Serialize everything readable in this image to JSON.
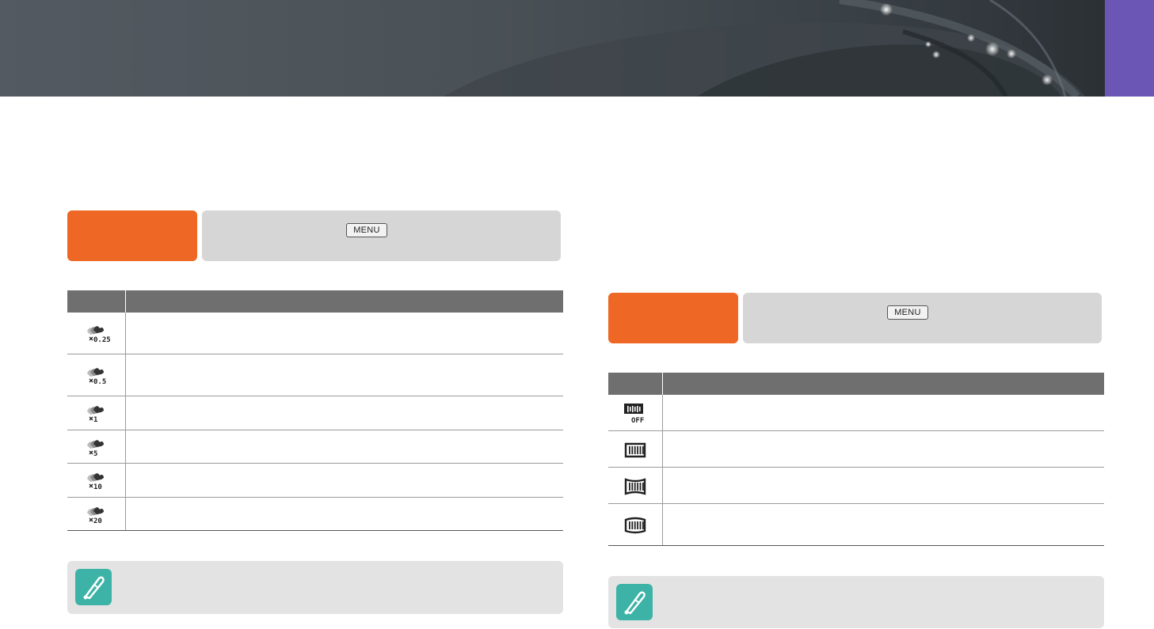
{
  "header": {
    "accent": "#6b55b5",
    "banner_color": "#4a5156"
  },
  "left_section": {
    "mode_color": "#ee6724",
    "menu_key": "MENU",
    "table_rows": [
      {
        "icon": "timelapse-x0.25-icon"
      },
      {
        "icon": "timelapse-x0.5-icon"
      },
      {
        "icon": "timelapse-x1-icon"
      },
      {
        "icon": "timelapse-x5-icon"
      },
      {
        "icon": "timelapse-x10-icon"
      },
      {
        "icon": "timelapse-x20-icon"
      }
    ],
    "note_icon": "pen-note-icon"
  },
  "right_section": {
    "mode_color": "#ee6724",
    "menu_key": "MENU",
    "table_rows": [
      {
        "icon": "dynamic-range-off-icon"
      },
      {
        "icon": "dynamic-range-low-icon"
      },
      {
        "icon": "dynamic-range-medium-icon"
      },
      {
        "icon": "dynamic-range-high-icon"
      }
    ],
    "note_icon": "pen-note-icon",
    "note_color": "#3cb3a6"
  }
}
